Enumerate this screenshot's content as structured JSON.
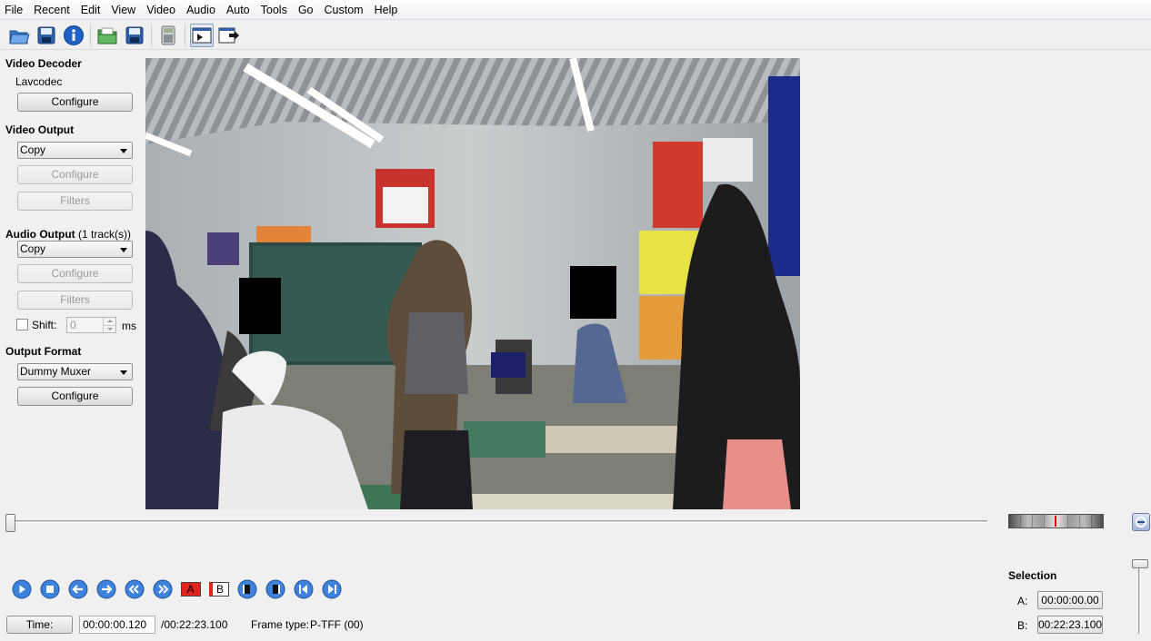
{
  "menu": [
    "File",
    "Recent",
    "Edit",
    "View",
    "Video",
    "Audio",
    "Auto",
    "Tools",
    "Go",
    "Custom",
    "Help"
  ],
  "toolbar": {
    "icons": [
      "open-icon",
      "save-icon",
      "info-icon",
      "open-folder-icon",
      "save-video-icon",
      "calculator-icon",
      "input-preview-icon",
      "output-preview-icon"
    ]
  },
  "video_decoder": {
    "title": "Video Decoder",
    "codec": "Lavcodec",
    "configure": "Configure"
  },
  "video_output": {
    "title": "Video Output",
    "selected": "Copy",
    "configure": "Configure",
    "filters": "Filters"
  },
  "audio_output": {
    "title": "Audio Output",
    "tracks": "(1 track(s))",
    "selected": "Copy",
    "configure": "Configure",
    "filters": "Filters",
    "shift_label": "Shift:",
    "shift_value": "0",
    "shift_unit": "ms"
  },
  "output_format": {
    "title": "Output Format",
    "selected": "Dummy Muxer",
    "configure": "Configure"
  },
  "playback": {
    "time_button": "Time:",
    "current_time": "00:00:00.120",
    "total_time": "/00:22:23.100",
    "frame_type_label": "Frame type:",
    "frame_type_value": "P-TFF (00)",
    "position": 0.0
  },
  "transport": {
    "marker_a": "A",
    "marker_b": "B",
    "icons": [
      "play-icon",
      "stop-icon",
      "previous-frame-icon",
      "next-frame-icon",
      "rewind-icon",
      "fast-forward-icon",
      "set-marker-a-icon",
      "set-marker-b-icon",
      "previous-black-frame-icon",
      "next-black-frame-icon",
      "first-frame-icon",
      "last-frame-icon"
    ]
  },
  "selection": {
    "title": "Selection",
    "a_label": "A:",
    "a_value": "00:00:00.00",
    "b_label": "B:",
    "b_value": "00:22:23.100"
  },
  "colors": {
    "accent": "#2f6fd0",
    "marker_red": "#e0231b"
  }
}
